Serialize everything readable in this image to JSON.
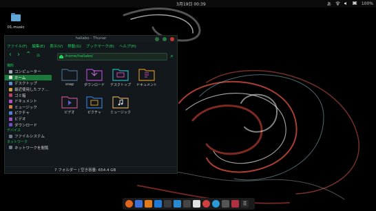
{
  "topbar": {
    "clock": "3月19日 00:39",
    "input_method": "あ",
    "battery": "100%"
  },
  "desktop": {
    "icon_label": "01.music"
  },
  "file_manager": {
    "title": "hallabo - Thunar",
    "menu": [
      "ファイル(F)",
      "編集(E)",
      "表示(V)",
      "移動(G)",
      "ブックマーク(B)",
      "ヘルプ(H)"
    ],
    "path": "/home/hallabo/",
    "sidebar": {
      "section_places": "場所",
      "places": [
        "コンピューター",
        "ホーム",
        "デスクトップ",
        "最近使用したファ...",
        "ゴミ箱",
        "ドキュメント",
        "ミュージック",
        "ピクチャ",
        "ビデオ",
        "ダウンロード"
      ],
      "section_devices": "デバイス",
      "devices": [
        "ファイルシステム"
      ],
      "section_network": "ネットワーク",
      "network": [
        "ネットワークを閲覧"
      ]
    },
    "folders": [
      "snap",
      "ダウンロード",
      "デスクトップ",
      "ドキュメント",
      "ビデオ",
      "ピクチャ",
      "ミュージック"
    ],
    "status": "7 フォルダー  |  空き容量: 654.4 GB"
  },
  "colors": {
    "accent": "#1fd35a",
    "selection": "#1b7a3a",
    "window_bg": "#12181c"
  }
}
